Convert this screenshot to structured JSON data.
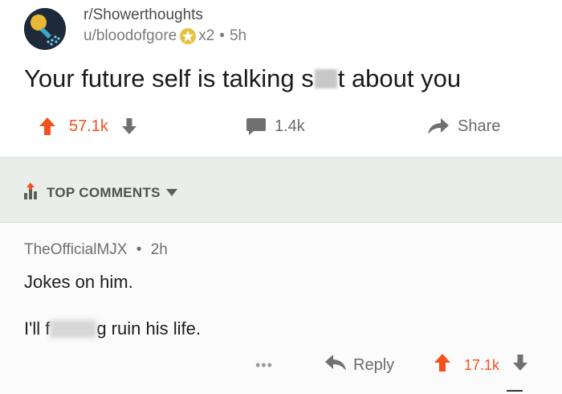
{
  "post": {
    "subreddit": "r/Showerthoughts",
    "author": "u/bloodofgore",
    "award_count": "x2",
    "separator": "•",
    "age": "5h",
    "title_start": "Your future self is talking s",
    "title_end": "t about you",
    "score": "57.1k",
    "comments": "1.4k",
    "share_label": "Share"
  },
  "sort": {
    "label": "TOP COMMENTS"
  },
  "comment": {
    "author": "TheOfficialMJX",
    "separator": "•",
    "age": "2h",
    "line1": "Jokes on him.",
    "line2_start": "I'll f",
    "line2_end": "g ruin his life.",
    "more": "•••",
    "reply_label": "Reply",
    "score": "17.1k"
  },
  "colors": {
    "upvote": "#f4511e",
    "icon_gray": "#707070",
    "sortbar_bg": "#e9eeea"
  },
  "icons": [
    "shower-avatar-icon",
    "award-icon",
    "upvote-arrow-icon",
    "downvote-arrow-icon",
    "comment-bubble-icon",
    "share-arrow-icon",
    "sort-bars-icon",
    "caret-down-icon",
    "reply-arrow-icon"
  ]
}
